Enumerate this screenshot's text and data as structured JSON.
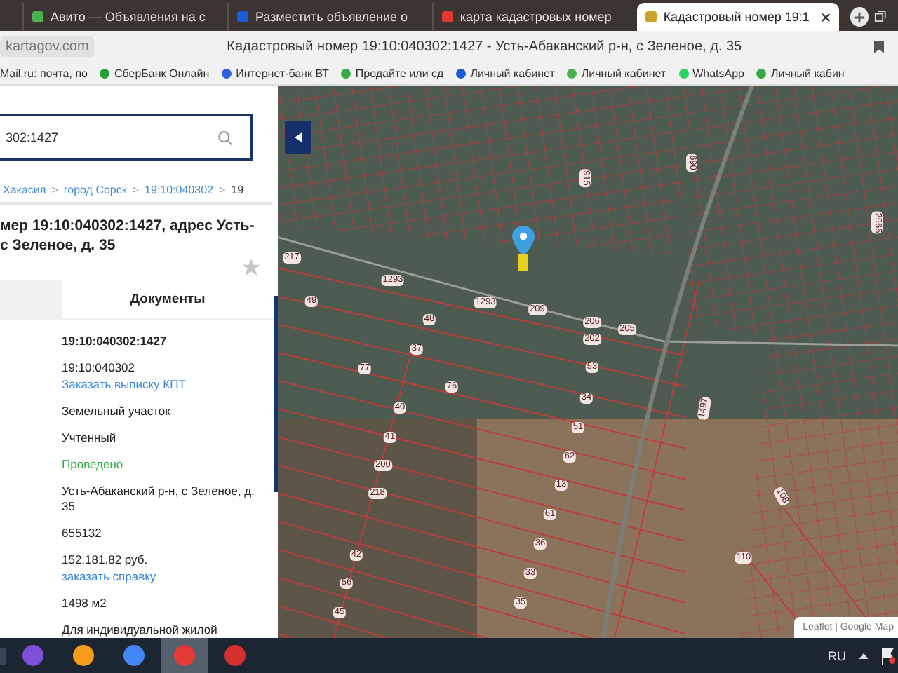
{
  "browser": {
    "tabs": [
      {
        "title": "Авито — Объявления на с",
        "selected": false
      },
      {
        "title": "Разместить объявление о",
        "selected": false
      },
      {
        "title": "карта кадастровых номер",
        "selected": false
      },
      {
        "title": "Кадастровый номер 19:1",
        "selected": true
      }
    ],
    "domain": "kartagov.com",
    "page_title": "Кадастровый номер 19:10:040302:1427 - Усть-Абаканский р-н, с Зеленое, д. 35",
    "bookmarks": [
      "Mail.ru: почта, по",
      "СберБанк Онлайн",
      "Интернет-банк ВТ",
      "Продайте или сд",
      "Личный кабинет",
      "Личный кабинет",
      "WhatsApp",
      "Личный кабин"
    ]
  },
  "panel": {
    "search": {
      "value": "302:1427"
    },
    "breadcrumbs": [
      "Хакасия",
      "город Сорск",
      "19:10:040302",
      "19"
    ],
    "breadcrumb_separator": ">",
    "heading": [
      "мер 19:10:040302:1427, адрес Усть-",
      "с Зеленое, д. 35"
    ],
    "favorite": false,
    "tabs": [
      {
        "label": "Документы",
        "selected": false
      }
    ],
    "rows": [
      {
        "value": "19:10:040302:1427",
        "kind": "bold"
      },
      {
        "value": "19:10:040302",
        "kind": "plain",
        "link": "Заказать выписку КПТ"
      },
      {
        "value": "Земельный участок",
        "kind": "plain"
      },
      {
        "value": "Учтенный",
        "kind": "plain"
      },
      {
        "value": "Проведено",
        "kind": "status"
      },
      {
        "value": "Усть-Абаканский р-н, с Зеленое, д. 35",
        "kind": "plain"
      },
      {
        "value": "655132",
        "kind": "plain"
      },
      {
        "value": "152,181.82 руб.",
        "kind": "plain",
        "link": "заказать справку"
      },
      {
        "value": "1498 м2",
        "kind": "plain"
      },
      {
        "value": "Для индивидуальной жилой",
        "kind": "plain"
      }
    ]
  },
  "map": {
    "parcels": [
      "217",
      "1293",
      "49",
      "1293",
      "209",
      "206",
      "205",
      "202",
      "48",
      "37",
      "77",
      "53",
      "76",
      "34",
      "40",
      "51",
      "41",
      "62",
      "200",
      "13",
      "218",
      "61",
      "36",
      "42",
      "110",
      "33",
      "56",
      "35",
      "45",
      "915",
      "690",
      "1497",
      "2965",
      "108"
    ],
    "attribution": "Leaflet | Google Map"
  },
  "taskbar": {
    "apps": [
      {
        "active": false
      },
      {
        "active": false
      },
      {
        "active": false
      },
      {
        "active": true
      },
      {
        "active": false
      }
    ],
    "language": "RU"
  }
}
